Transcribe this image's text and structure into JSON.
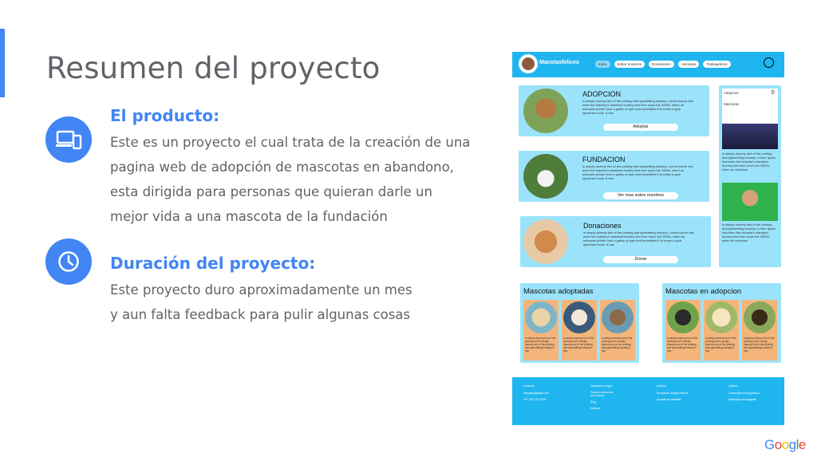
{
  "slide": {
    "title": "Resumen del proyecto",
    "product": {
      "title": "El producto:",
      "lines": [
        "Este es un proyecto el cual trata de la creación de una",
        "pagina web de adopción de mascotas en abandono,",
        "esta dirigida para personas que quieran darle un",
        "mejor vida a una mascota de la fundación"
      ]
    },
    "duration": {
      "title": "Duración del proyecto:",
      "lines": [
        "Este proyecto duro aproximadamente un mes",
        "y aun falta feedback para pulir algunas cosas"
      ]
    }
  },
  "mockup": {
    "brand": "Macotasfelices",
    "nav": [
      "Inicio",
      "Sobre nosotros",
      "Donaciones",
      "Animales",
      "Trabajadores"
    ],
    "lorem": "is simply dummy text of the printing and typesetting industry. Lorem Ipsum has been the industry's standard dummy text ever since the 1500s, when an unknown printer took a galley of type and scrambled it to make a type specimen book. It has",
    "cards": [
      {
        "title": "ADOPCION",
        "button": "Adoptar"
      },
      {
        "title": "FUNDACION",
        "button": "Ver mas sobre nosotros"
      },
      {
        "title": "Donaciones",
        "button": "Donar"
      }
    ],
    "sidebar": {
      "search_value": "Adopcion",
      "search_hint": "Mascotas",
      "text": "is simply dummy text of the printing and typesetting industry. Lorem Ipsum has been the industry's standard dummy text ever since the 1500s, when an unknown"
    },
    "adoptadas": {
      "title": "Mascotas adoptadas"
    },
    "en_adopcion": {
      "title": "Mascotas en adopcion"
    },
    "pet_text": "is simply dummy text of the printing and is simply dummy text of the printing and typesetting industry if has",
    "footer": [
      {
        "heading": "Contacto",
        "items": [
          "ejemplo@gmail.com",
          "+57 312 729 3126"
        ]
      },
      {
        "heading": "Informacion legal",
        "items": [
          "Todos lo derechos reservados",
          "Blog",
          "Noticias"
        ]
      },
      {
        "heading": "Aliados",
        "items": [
          "Fundacion amigos felices",
          "Alcaldia de medellin"
        ]
      },
      {
        "heading": "Lideres",
        "items": [
          "Camilo@correo@yahoo.t",
          "Felipe@correo@gmail"
        ]
      }
    ]
  },
  "brand_logo": "Google",
  "colors": {
    "accent": "#4285f4",
    "text": "#5f6368",
    "nav": "#1fb6f0",
    "card": "#9be3fb",
    "pet": "#f4b57a"
  }
}
